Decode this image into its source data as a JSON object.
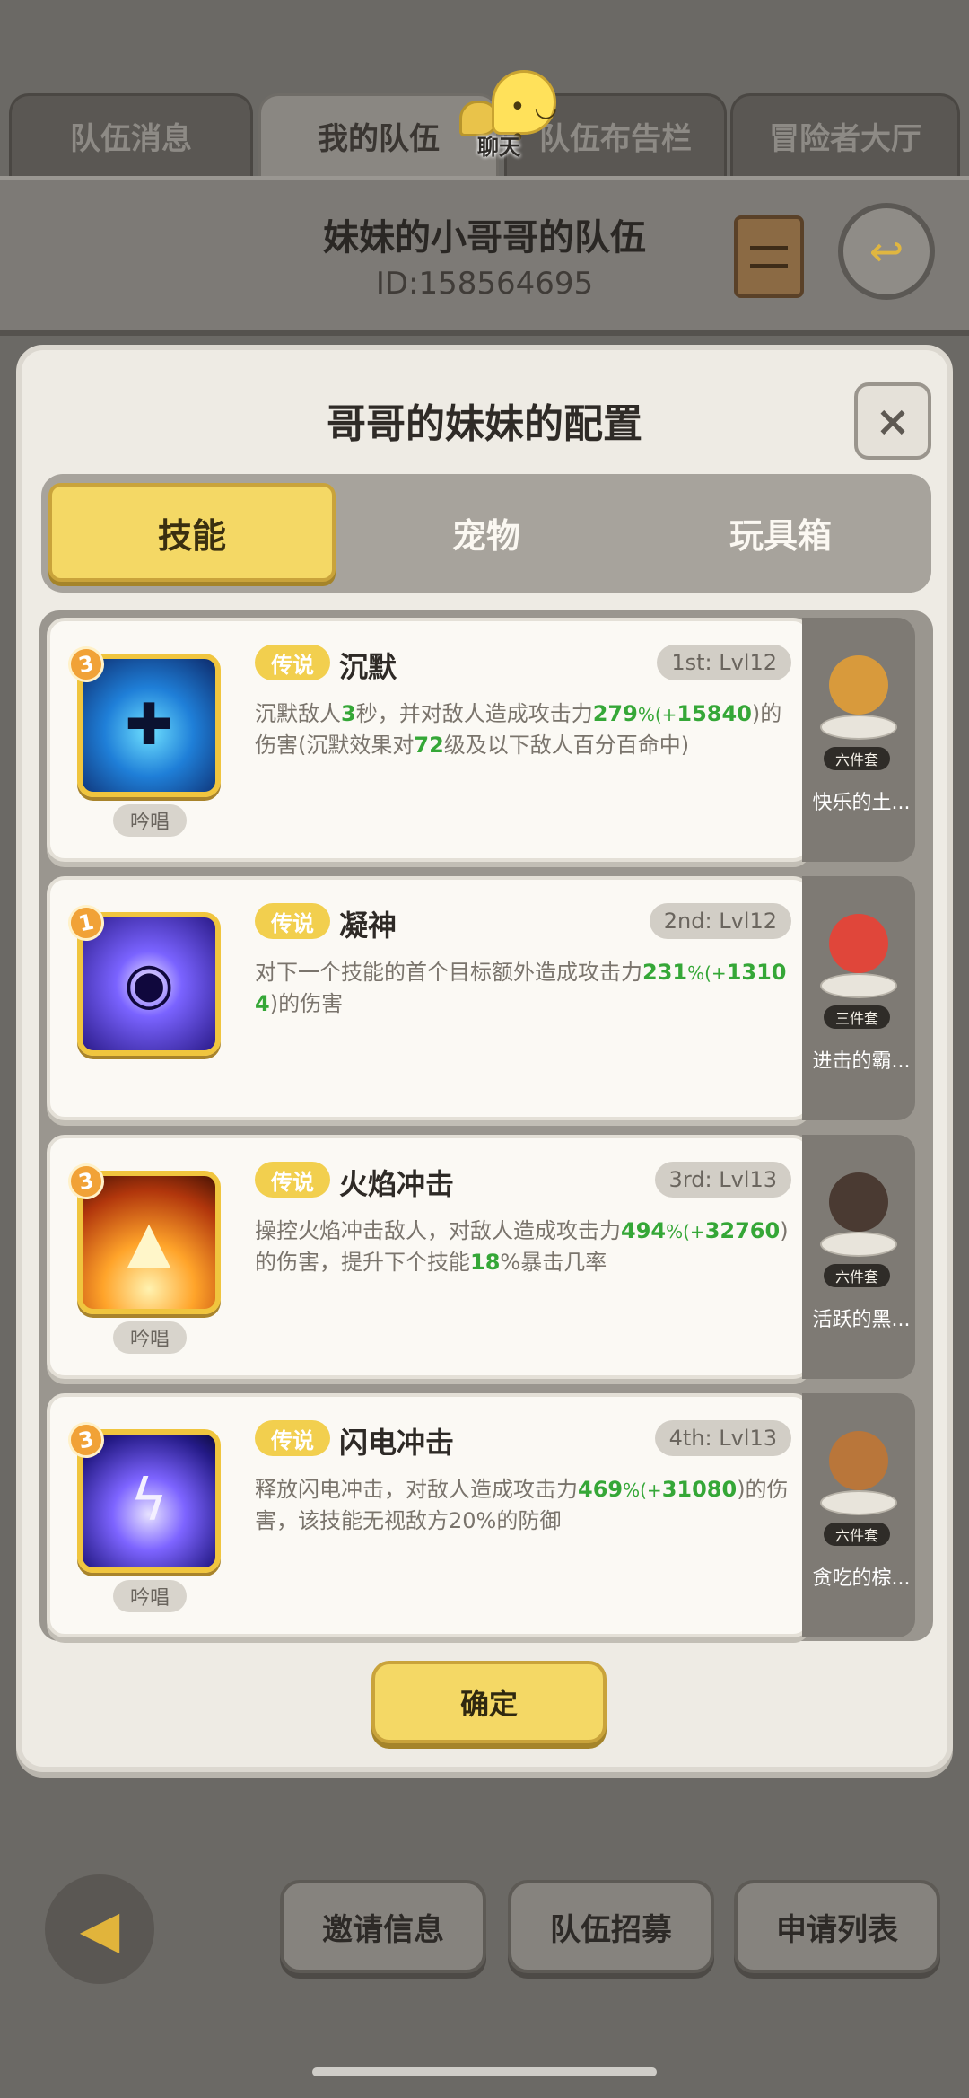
{
  "top_tabs": [
    {
      "label": "队伍消息",
      "active": false
    },
    {
      "label": "我的队伍",
      "active": true
    },
    {
      "label": "队伍布告栏",
      "active": false
    },
    {
      "label": "冒险者大厅",
      "active": false
    }
  ],
  "chat": {
    "label": "聊天"
  },
  "team": {
    "name": "妹妹的小哥哥的队伍",
    "id": "ID:158564695"
  },
  "modal": {
    "title": "哥哥的妹妹的配置",
    "close_label": "×",
    "tabs": [
      {
        "label": "技能",
        "active": true
      },
      {
        "label": "宠物",
        "active": false
      },
      {
        "label": "玩具箱",
        "active": false
      }
    ],
    "confirm_label": "确定"
  },
  "skills": [
    {
      "level": "3",
      "rarity": "传说",
      "name": "沉默",
      "slot": "1st: Lvl12",
      "tag": "吟唱",
      "desc_parts": [
        {
          "t": "沉默敌人",
          "c": "n"
        },
        {
          "t": "3",
          "c": "g"
        },
        {
          "t": "秒，并对敌人造成攻击力",
          "c": "n"
        },
        {
          "t": "279",
          "c": "g"
        },
        {
          "t": "%(+",
          "c": "gs"
        },
        {
          "t": "15840",
          "c": "g"
        },
        {
          "t": ")的伤害(沉默效果对",
          "c": "n"
        },
        {
          "t": "72",
          "c": "g"
        },
        {
          "t": "级及以下敌人百分百命中)",
          "c": "n"
        }
      ],
      "pet": {
        "name": "快乐的土...",
        "set": "六件套",
        "color": "#d89a3c"
      }
    },
    {
      "level": "1",
      "rarity": "传说",
      "name": "凝神",
      "slot": "2nd: Lvl12",
      "tag": "",
      "desc_parts": [
        {
          "t": "对下一个技能的首个目标额外造成攻击力",
          "c": "n"
        },
        {
          "t": "231",
          "c": "g"
        },
        {
          "t": "%(+",
          "c": "gs"
        },
        {
          "t": "13104",
          "c": "g"
        },
        {
          "t": ")的伤害",
          "c": "n"
        }
      ],
      "pet": {
        "name": "进击的霸...",
        "set": "三件套",
        "color": "#e0463a"
      }
    },
    {
      "level": "3",
      "rarity": "传说",
      "name": "火焰冲击",
      "slot": "3rd: Lvl13",
      "tag": "吟唱",
      "desc_parts": [
        {
          "t": "操控火焰冲击敌人，对敌人造成攻击力",
          "c": "n"
        },
        {
          "t": "494",
          "c": "g"
        },
        {
          "t": "%(+",
          "c": "gs"
        },
        {
          "t": "32760",
          "c": "g"
        },
        {
          "t": ")的伤害，提升下个技能",
          "c": "n"
        },
        {
          "t": "18",
          "c": "g"
        },
        {
          "t": "%暴击几率",
          "c": "n"
        }
      ],
      "pet": {
        "name": "活跃的黑...",
        "set": "六件套",
        "color": "#4a3a32"
      }
    },
    {
      "level": "3",
      "rarity": "传说",
      "name": "闪电冲击",
      "slot": "4th: Lvl13",
      "tag": "吟唱",
      "desc_parts": [
        {
          "t": "释放闪电冲击，对敌人造成攻击力",
          "c": "n"
        },
        {
          "t": "469",
          "c": "g"
        },
        {
          "t": "%(+",
          "c": "gs"
        },
        {
          "t": "31080",
          "c": "g"
        },
        {
          "t": ")的伤害，该技能无视敌方20%的防御",
          "c": "n"
        }
      ],
      "pet": {
        "name": "贪吃的棕...",
        "set": "六件套",
        "color": "#b9763a"
      }
    }
  ],
  "bottom": {
    "invite_label": "邀请信息",
    "recruit_label": "队伍招募",
    "apply_label": "申请列表"
  },
  "colors": {
    "accent_yellow": "#f4d865",
    "value_green": "#35a737",
    "rarity_gold": "#f2cf4e"
  },
  "icons": [
    "chat-bubble-icon",
    "scroll-icon",
    "exit-icon",
    "close-icon",
    "back-arrow-icon"
  ]
}
